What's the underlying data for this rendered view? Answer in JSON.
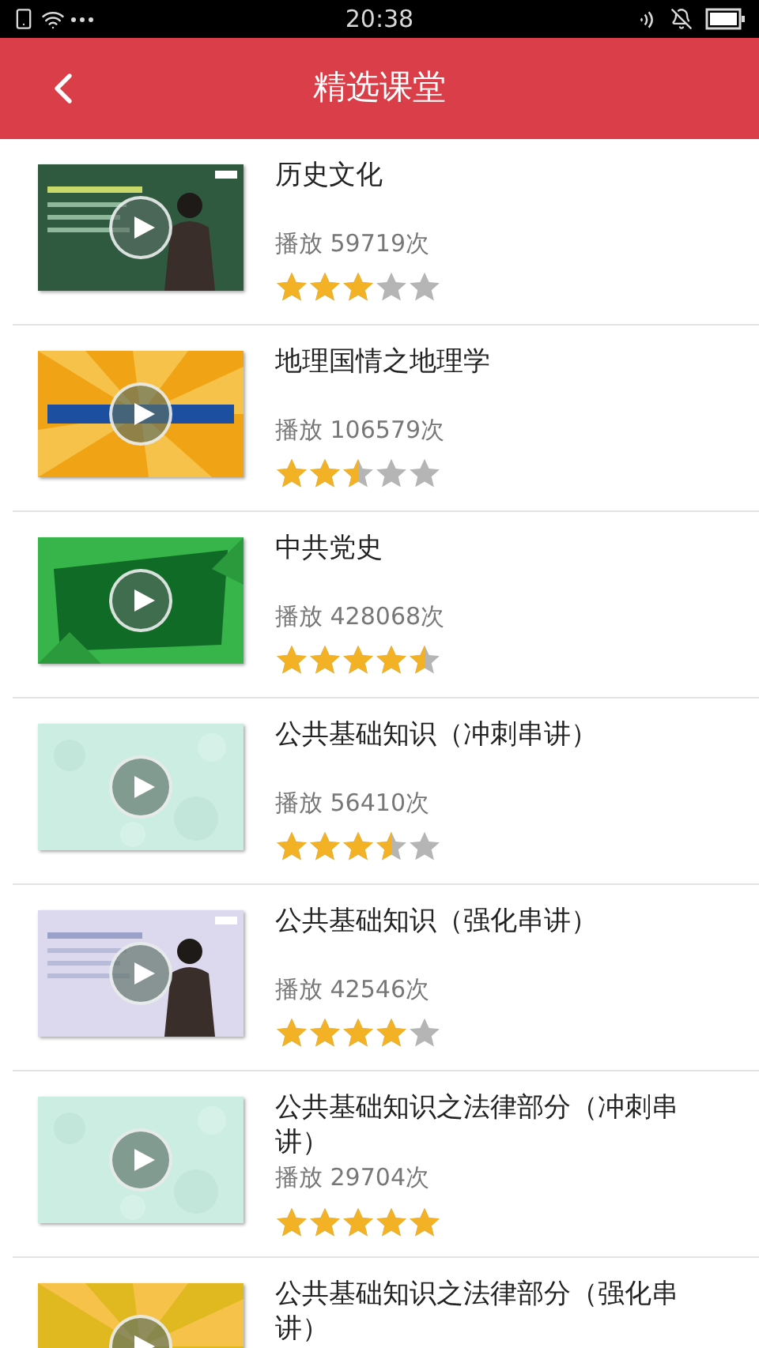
{
  "status_bar": {
    "time": "20:38"
  },
  "header": {
    "title": "精选课堂"
  },
  "courses": [
    {
      "title": "历史文化",
      "plays": "播放 59719次",
      "stars": 3
    },
    {
      "title": "地理国情之地理学",
      "plays": "播放 106579次",
      "stars": 2.5
    },
    {
      "title": "中共党史",
      "plays": "播放 428068次",
      "stars": 4.5
    },
    {
      "title": "公共基础知识（冲刺串讲）",
      "plays": "播放 56410次",
      "stars": 3.5
    },
    {
      "title": "公共基础知识（强化串讲）",
      "plays": "播放 42546次",
      "stars": 4
    },
    {
      "title": "公共基础知识之法律部分（冲刺串讲）",
      "plays": "播放 29704次",
      "stars": 5
    },
    {
      "title": "公共基础知识之法律部分（强化串讲）"
    }
  ]
}
